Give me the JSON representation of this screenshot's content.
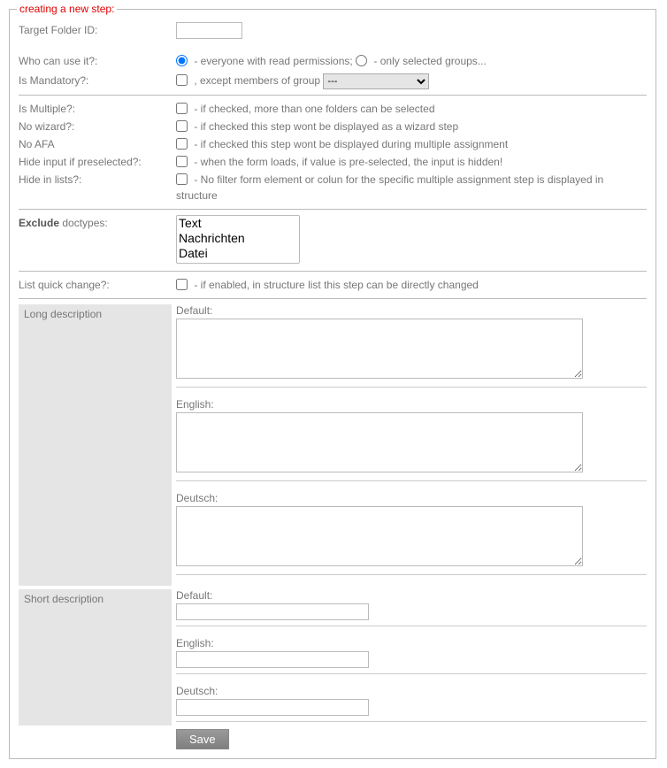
{
  "legend": "creating a new step:",
  "targetFolder": {
    "label": "Target Folder ID:",
    "value": ""
  },
  "whoCanUse": {
    "label": "Who can use it?:",
    "opt1": "  - everyone with read permissions;  ",
    "opt2": "  - only selected groups..."
  },
  "isMandatory": {
    "label": "Is Mandatory?:",
    "text": " , except members of group ",
    "selectValue": "---"
  },
  "isMultiple": {
    "label": "Is Multiple?:",
    "hint": "  - if checked, more than one folders can be selected"
  },
  "noWizard": {
    "label": "No wizard?:",
    "hint": "  - if checked this step wont be displayed as a wizard step"
  },
  "noAfa": {
    "label": "No AFA",
    "hint": "  - if checked this step wont be displayed during multiple assignment"
  },
  "hideInput": {
    "label": "Hide input if preselected?:",
    "hint": "  - when the form loads, if value is pre-selected, the input is hidden!"
  },
  "hideLists": {
    "label": "Hide in lists?:",
    "hint": "  - No filter form element or colun for the specific multiple assignment step is displayed in structure"
  },
  "exclude": {
    "label": "Exclude doctypes:",
    "options": [
      "Text",
      "Nachrichten",
      "Datei"
    ]
  },
  "listQuick": {
    "label": "List quick change?:",
    "hint": "  - if enabled, in structure list this step can be directly changed"
  },
  "longDesc": {
    "title": "Long description",
    "default": "Default:",
    "english": "English:",
    "deutsch": "Deutsch:"
  },
  "shortDesc": {
    "title": "Short description",
    "default": "Default:",
    "english": "English:",
    "deutsch": "Deutsch:"
  },
  "saveLabel": "Save"
}
